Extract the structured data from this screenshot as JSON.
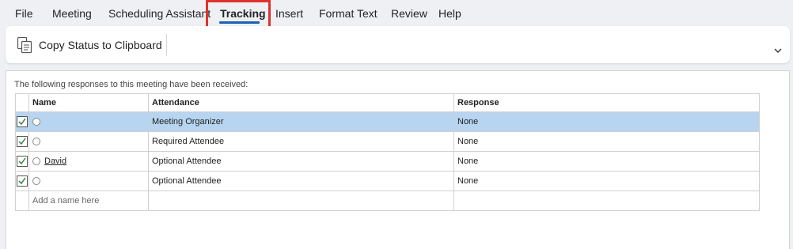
{
  "tabs": [
    {
      "label": "File"
    },
    {
      "label": "Meeting"
    },
    {
      "label": "Scheduling Assistant"
    },
    {
      "label": "Tracking"
    },
    {
      "label": "Insert"
    },
    {
      "label": "Format Text"
    },
    {
      "label": "Review"
    },
    {
      "label": "Help"
    }
  ],
  "ribbon": {
    "copy_status_label": "Copy Status to Clipboard"
  },
  "tracking": {
    "message": "The following responses to this meeting have been received:",
    "columns": {
      "name": "Name",
      "attendance": "Attendance",
      "response": "Response"
    },
    "rows": [
      {
        "checked": true,
        "name": "",
        "attendance": "Meeting Organizer",
        "response": "None"
      },
      {
        "checked": true,
        "name": "",
        "attendance": "Required Attendee",
        "response": "None"
      },
      {
        "checked": true,
        "name": "David",
        "attendance": "Optional Attendee",
        "response": "None"
      },
      {
        "checked": true,
        "name": "",
        "attendance": "Optional Attendee",
        "response": "None"
      }
    ],
    "add_placeholder": "Add a name here"
  },
  "colors": {
    "accent": "#1f5eb8",
    "selection": "#b7d4f0",
    "highlight": "#e0322c",
    "check": "#2e7d32"
  }
}
